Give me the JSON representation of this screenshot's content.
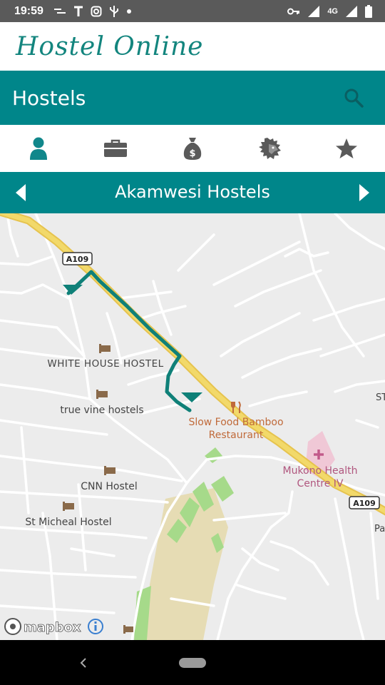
{
  "status_bar": {
    "time": "19:59",
    "network": "4G",
    "left_icons": [
      "sms-icon",
      "text-t-icon",
      "instagram-icon",
      "usb-icon",
      "dot-icon"
    ],
    "right_icons": [
      "key-icon",
      "signal-icon",
      "signal-4g-icon",
      "battery-icon"
    ]
  },
  "brand": {
    "title": "Hostel Online"
  },
  "toolbar": {
    "title": "Hostels"
  },
  "tabs": [
    {
      "name": "person-icon",
      "active": true
    },
    {
      "name": "briefcase-icon",
      "active": false
    },
    {
      "name": "money-bag-icon",
      "active": false
    },
    {
      "name": "lion-icon",
      "active": false
    },
    {
      "name": "star-icon",
      "active": false
    }
  ],
  "selector": {
    "current": "Akamwesi Hostels"
  },
  "map": {
    "road_labels": {
      "a109_top": "A109",
      "a109_right": "A109"
    },
    "places": {
      "white_house": "WHITE HOUSE HOSTEL",
      "true_vine": "true vine hostels",
      "slow_food_line1": "Slow Food Bamboo",
      "slow_food_line2": "Restaurant",
      "mukono_line1": "Mukono Health",
      "mukono_line2": "Centre IV",
      "cnn": "CNN Hostel",
      "st_micheal": "St Micheal Hostel",
      "edge_st": "ST",
      "edge_pa": "Pa"
    },
    "attribution": "mapbox",
    "colors": {
      "route": "#0f8078",
      "main_road": "#f0d35c",
      "land": "#ececec",
      "park": "#a6da8a",
      "market": "#e6dcb4",
      "hospital": "#f0c8d6"
    }
  },
  "colors": {
    "accent": "#00868a",
    "brand_text": "#13857e",
    "icon_gray": "#5a5a5a"
  }
}
